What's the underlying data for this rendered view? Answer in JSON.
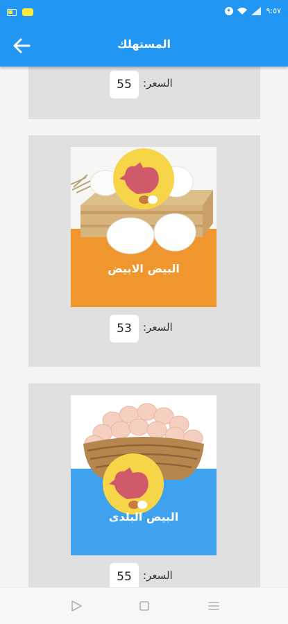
{
  "status_bar": {
    "time": "٩:٥٧"
  },
  "app_bar": {
    "title": "المستهلك"
  },
  "products": [
    {
      "price_label": "السعر:",
      "price": "55"
    },
    {
      "price_label": "السعر:",
      "price": "53",
      "image_caption": "البيض الابيض"
    },
    {
      "price_label": "السعر:",
      "price": "55",
      "image_caption": "البيض البلدى"
    }
  ],
  "colors": {
    "primary": "#2196f3",
    "card": "#e0e0e0",
    "orange": "#f0962e",
    "badge": "#f7d548",
    "hen": "#d05a6a"
  },
  "icons": {
    "back": "arrow-left-icon",
    "nav_back": "triangle-back-icon",
    "nav_home": "square-home-icon",
    "nav_menu": "menu-lines-icon"
  }
}
